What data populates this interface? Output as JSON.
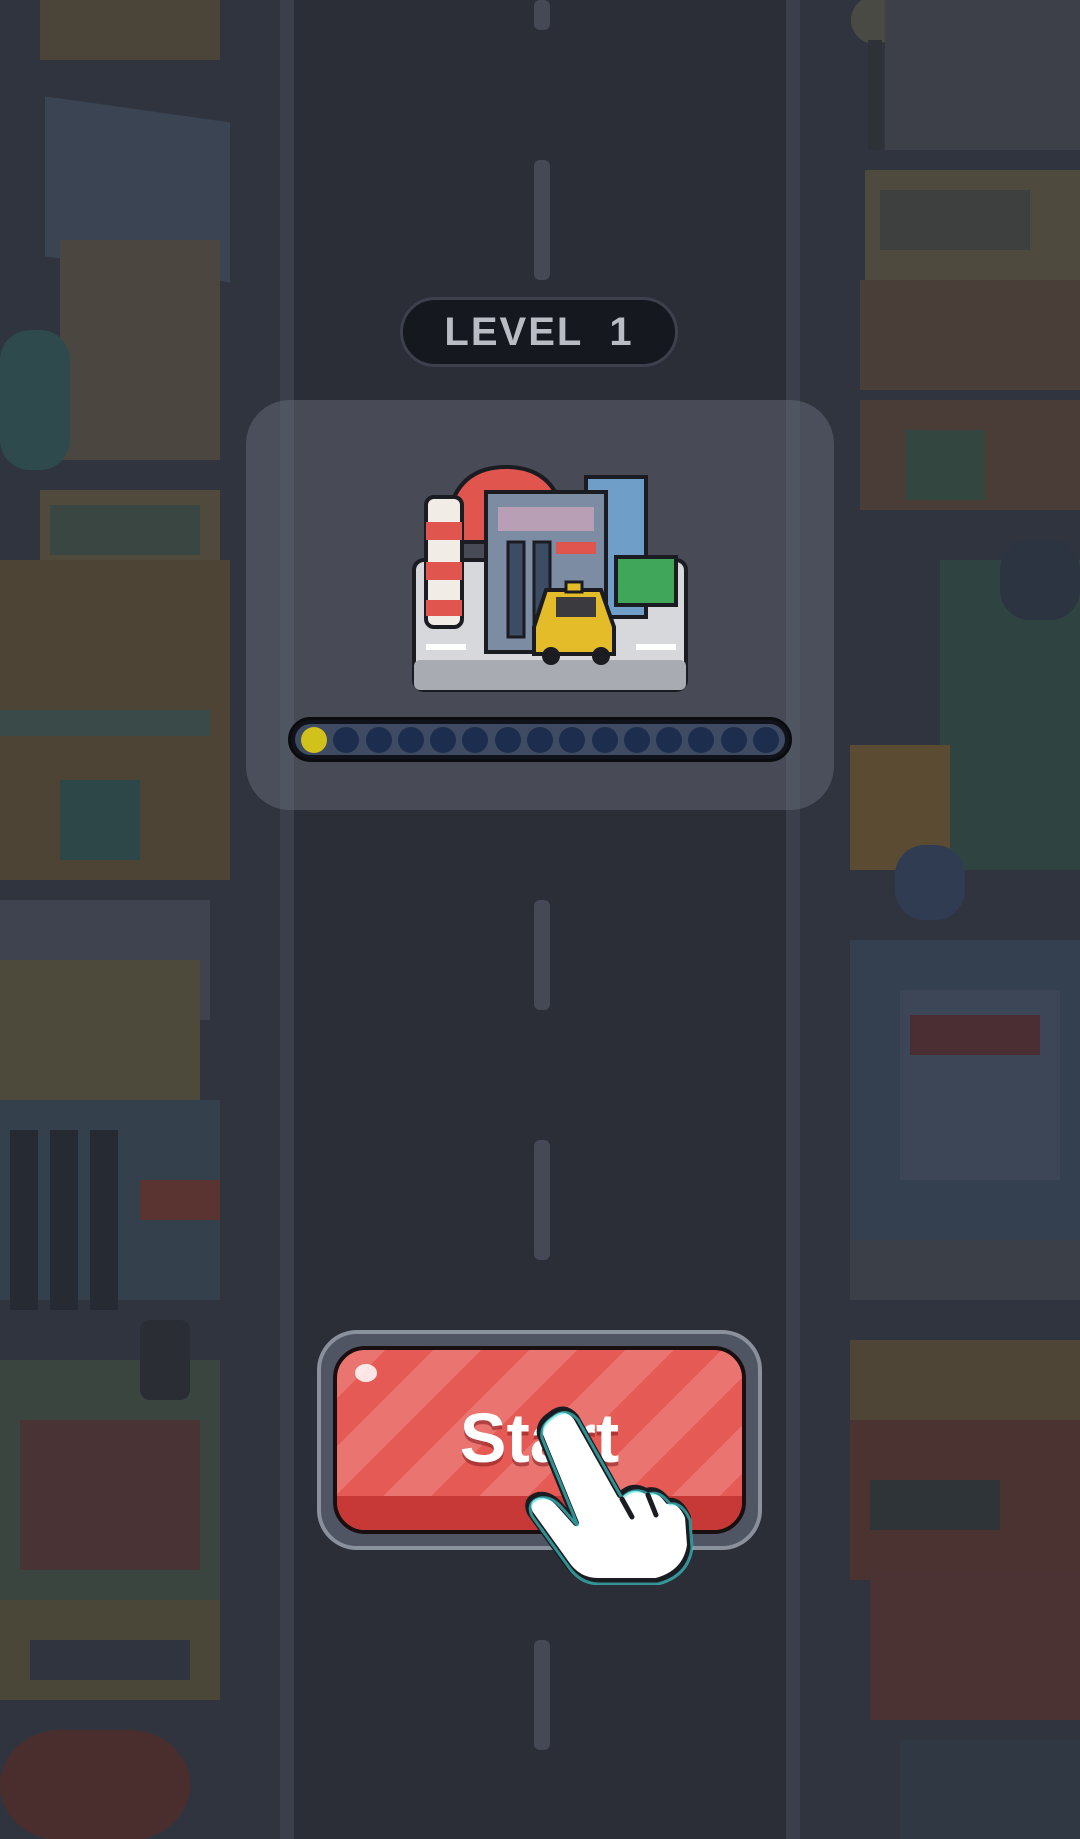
{
  "level": {
    "label": "LEVEL",
    "number": "1"
  },
  "progress": {
    "current_stage": 1,
    "total_stages": 15
  },
  "start_button": {
    "label": "Start"
  },
  "colors": {
    "overlay_bg": "#2f3440",
    "button_red": "#e65a55",
    "progress_done": "#d1c11b",
    "progress_pending": "#1d2d4d"
  },
  "icons": {
    "preview": "city-taxi-icon",
    "pointer": "tap-hand-icon"
  }
}
